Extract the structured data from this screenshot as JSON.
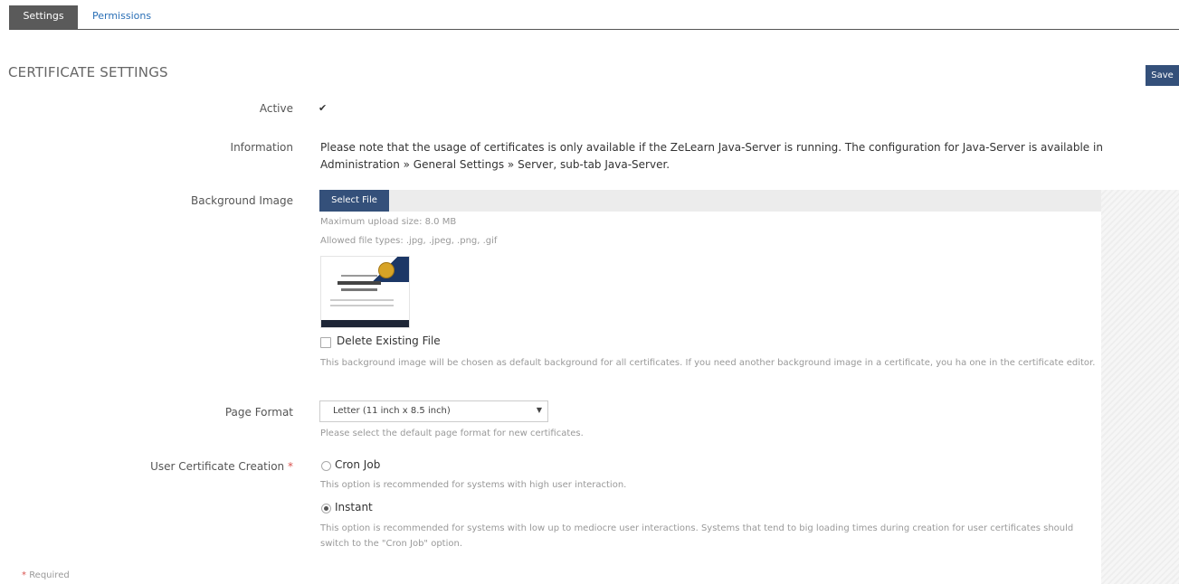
{
  "tabs": [
    {
      "label": "Settings",
      "active": true
    },
    {
      "label": "Permissions",
      "active": false
    }
  ],
  "section": {
    "title": "CERTIFICATE SETTINGS",
    "save_label": "Save"
  },
  "fields": {
    "active": {
      "label": "Active",
      "checked": true
    },
    "information": {
      "label": "Information",
      "text": "Please note that the usage of certificates is only available if the ZeLearn Java-Server is running. The configuration for Java-Server is available in Administration » General Settings » Server, sub-tab Java-Server."
    },
    "background_image": {
      "label": "Background Image",
      "select_label": "Select File",
      "max_upload": "Maximum upload size: 8.0 MB",
      "allowed_types": "Allowed file types: .jpg, .jpeg, .png, .gif",
      "delete_label": "Delete Existing File",
      "help": "This background image will be chosen as default background for all certificates. If you need another background image in a certificate, you ha one in the certificate editor."
    },
    "page_format": {
      "label": "Page Format",
      "selected": "Letter (11 inch x 8.5 inch)",
      "help": "Please select the default page format for new certificates."
    },
    "user_certificate_creation": {
      "label": "User Certificate Creation",
      "required_mark": "*",
      "options": [
        {
          "label": "Cron Job",
          "selected": false,
          "help": "This option is recommended for systems with high user interaction."
        },
        {
          "label": "Instant",
          "selected": true,
          "help": "This option is recommended for systems with low up to mediocre user interactions. Systems that tend to big loading times during creation for user certificates should switch to the \"Cron Job\" option."
        }
      ]
    }
  },
  "footer": {
    "required_mark": "*",
    "required_text": "Required"
  }
}
